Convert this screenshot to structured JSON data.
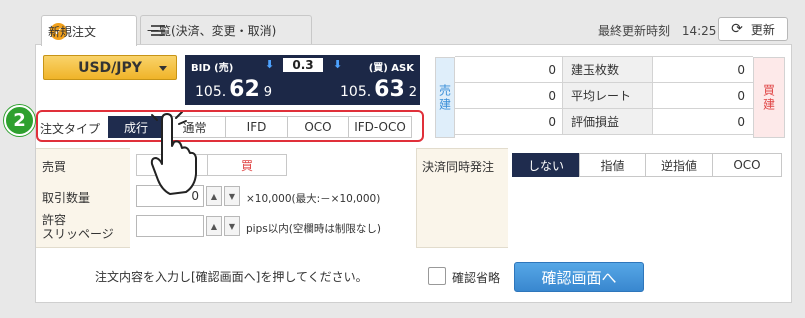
{
  "tabs": [
    {
      "label": "新規注文",
      "active": true
    },
    {
      "label": "一覧(決済、変更・取消)",
      "active": false
    }
  ],
  "header": {
    "last_update_label": "最終更新時刻",
    "last_update_time": "14:25",
    "refresh_label": "更新"
  },
  "pair": {
    "selected": "USD/JPY"
  },
  "board": {
    "bid_label": "BID (売)",
    "ask_label": "(買) ASK",
    "spread": "0.3",
    "bid": {
      "small": "105.",
      "big": "62",
      "tail": "9"
    },
    "ask": {
      "small": "105.",
      "big": "63",
      "tail": "2"
    }
  },
  "positions": {
    "sell_label": "売建",
    "buy_label": "買建",
    "rows": [
      {
        "sell_value": "0",
        "label": "建玉枚数",
        "buy_value": "0"
      },
      {
        "sell_value": "0",
        "label": "平均レート",
        "buy_value": "0"
      },
      {
        "sell_value": "0",
        "label": "評価損益",
        "buy_value": "0"
      }
    ]
  },
  "order_type": {
    "label": "注文タイプ",
    "options": [
      "成行",
      "通常",
      "IFD",
      "OCO",
      "IFD-OCO"
    ],
    "selected": "成行"
  },
  "step_number": "2",
  "form": {
    "side_label": "売買",
    "sell_label": "売",
    "buy_label": "買",
    "qty_label": "取引数量",
    "qty_value": "0",
    "qty_note": "×10,000(最大:－×10,000)",
    "slip_label_1": "許容",
    "slip_label_2": "スリッページ",
    "slip_value": "",
    "slip_note": "pips以内(空欄時は制限なし)",
    "settle_label": "決済同時発注",
    "settle_options": [
      "しない",
      "指値",
      "逆指値",
      "OCO"
    ],
    "settle_selected": "しない"
  },
  "footer": {
    "note": "注文内容を入力し[確認画面へ]を押してください。",
    "skip_label": "確認省略",
    "confirm_label": "確認画面へ"
  },
  "colors": {
    "accent_navy": "#1f2c4e",
    "pair_yellow": "#f0b429",
    "confirm_blue": "#3f8fd6",
    "highlight_red": "#e0303a",
    "step_green": "#2fa02f"
  }
}
